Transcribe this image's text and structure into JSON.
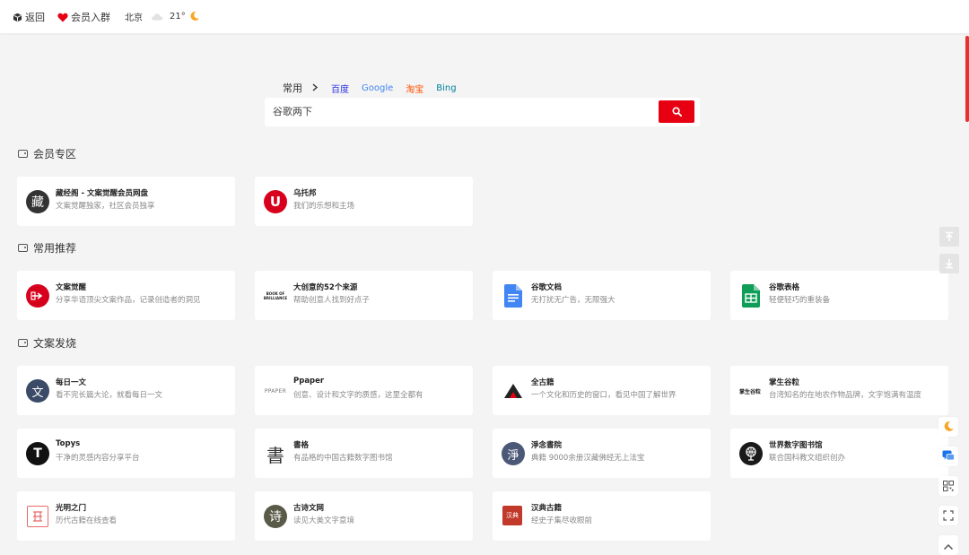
{
  "topbar": {
    "back_label": "返回",
    "member_label": "会员入群",
    "city": "北京",
    "temperature": "21°",
    "icons": [
      "cube-icon",
      "heart-icon",
      "cloud-icon",
      "moon-icon"
    ]
  },
  "search": {
    "category": "常用",
    "engines": [
      {
        "label": "百度",
        "color": "#2932e1"
      },
      {
        "label": "Google",
        "color": "#4285f4"
      },
      {
        "label": "淘宝",
        "color": "#ff5000"
      },
      {
        "label": "Bing",
        "color": "#00809d"
      }
    ],
    "value": "谷歌两下"
  },
  "sections": [
    {
      "title": "会员专区",
      "cards": [
        {
          "name": "藏经阁 - 文案觉醒会员网盘",
          "desc": "文案觉醒独家，社区会员独享",
          "logo": "藏"
        },
        {
          "name": "乌托邦",
          "desc": "我们的乐想和主场",
          "logo": "U"
        }
      ]
    },
    {
      "title": "常用推荐",
      "cards": [
        {
          "name": "文案觉醒",
          "desc": "分享华语顶尖文案作品，记录创造者的洞见",
          "logo": ""
        },
        {
          "name": "大创意的52个来源",
          "desc": "帮助创意人找到好点子",
          "logo": "BOOK OF BRILLIANCE"
        },
        {
          "name": "谷歌文档",
          "desc": "无打扰无广告，无限强大",
          "logo": ""
        },
        {
          "name": "谷歌表格",
          "desc": "轻便轻巧的重装备",
          "logo": ""
        }
      ]
    },
    {
      "title": "文案发烧",
      "cards": [
        {
          "name": "每日一文",
          "desc": "看不完长篇大论，就看每日一文",
          "logo": "文"
        },
        {
          "name": "Ppaper",
          "desc": "创意、设计和文字的质感，这里全都有",
          "logo": "PPAPER"
        },
        {
          "name": "全古籍",
          "desc": "一个文化和历史的窗口，看见中国了解世界",
          "logo": ""
        },
        {
          "name": "掌生谷粒",
          "desc": "台湾知名的在地农作物品牌，文字饱满有温度",
          "logo": "掌生谷粒"
        },
        {
          "name": "Topys",
          "desc": "干净的灵感内容分享平台",
          "logo": "T"
        },
        {
          "name": "書格",
          "desc": "有品格的中国古籍数字图书馆",
          "logo": "書"
        },
        {
          "name": "淨念書院",
          "desc": "典籍 9000余册汉藏佛经无上法宝",
          "logo": "淨"
        },
        {
          "name": "世界数字图书馆",
          "desc": "联合国科教文组织创办",
          "logo": ""
        },
        {
          "name": "光明之门",
          "desc": "历代古籍在线查看",
          "logo": ""
        },
        {
          "name": "古诗文网",
          "desc": "读见大美文字意境",
          "logo": "诗"
        },
        {
          "name": "汉典古籍",
          "desc": "经史子集尽收眼前",
          "logo": "汉典"
        }
      ]
    }
  ],
  "side_tools": [
    "back-to-top-icon",
    "go-bottom-icon",
    "moon-icon",
    "chat-icon",
    "qrcode-icon",
    "fullscreen-icon",
    "chevron-up-icon"
  ],
  "accent_color": "#e60012"
}
